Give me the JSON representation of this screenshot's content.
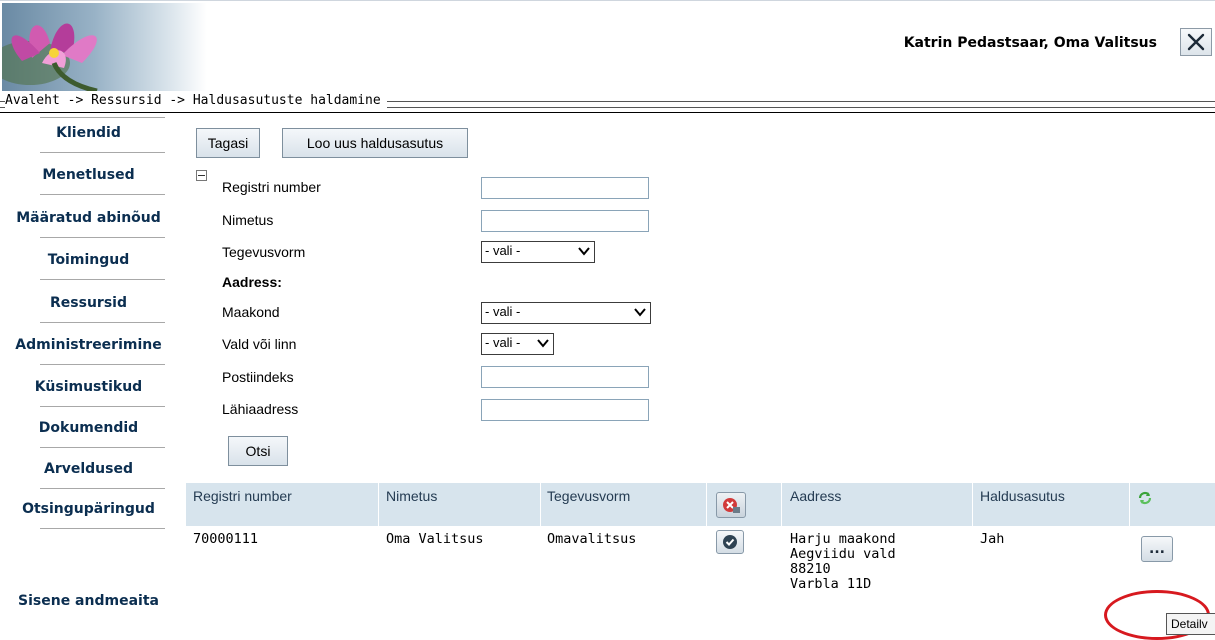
{
  "header": {
    "user_label": "Katrin Pedastsaar, Oma Valitsus",
    "close_label": "X"
  },
  "breadcrumb": "Avaleht -> Ressursid -> Haldusasutuste haldamine",
  "sidebar": {
    "items": [
      {
        "label": "Kliendid"
      },
      {
        "label": "Menetlused"
      },
      {
        "label": "Määratud abinõud"
      },
      {
        "label": "Toimingud"
      },
      {
        "label": "Ressursid"
      },
      {
        "label": "Administreerimine"
      },
      {
        "label": "Küsimustikud"
      },
      {
        "label": "Dokumendid"
      },
      {
        "label": "Arveldused"
      },
      {
        "label": "Otsingupäringud"
      }
    ],
    "bottom_item": "Sisene andmeaita"
  },
  "toolbar": {
    "back_label": "Tagasi",
    "new_label": "Loo uus haldusasutus"
  },
  "form": {
    "registry_number_label": "Registri number",
    "name_label": "Nimetus",
    "activity_form_label": "Tegevusvorm",
    "activity_form_value": "- vali -",
    "address_heading": "Aadress:",
    "county_label": "Maakond",
    "county_value": "- vali -",
    "municipality_label": "Vald või linn",
    "municipality_value": "- vali -",
    "postal_code_label": "Postiindeks",
    "address_label": "Lähiaadress",
    "search_label": "Otsi"
  },
  "table": {
    "headers": {
      "registry_number": "Registri number",
      "name": "Nimetus",
      "activity_form": "Tegevusvorm",
      "address": "Aadress",
      "authority": "Haldusasutus"
    },
    "rows": [
      {
        "registry_number": "70000111",
        "name": "Oma Valitsus",
        "activity_form": "Omavalitsus",
        "address_line1": "Harju maakond",
        "address_line2": "Aegviidu vald",
        "address_line3": "88210",
        "address_line4": "Varbla 11D",
        "authority": "Jah",
        "details_button": "..."
      }
    ]
  },
  "tooltip": "Detailv",
  "colors": {
    "header_row": "#d7e4ed",
    "sidebar_text": "#0b2e50",
    "highlight": "#d7191f"
  }
}
